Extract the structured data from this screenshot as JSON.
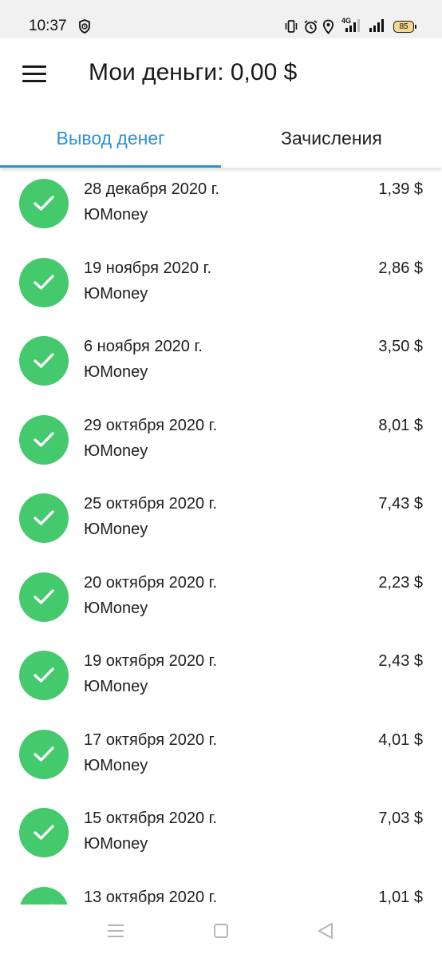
{
  "status_bar": {
    "time": "10:37",
    "battery": "85",
    "icons": [
      "shield-clock-icon",
      "vibrate-icon",
      "alarm-icon",
      "location-icon",
      "signal-4g-icon",
      "signal-icon",
      "battery-icon"
    ]
  },
  "header": {
    "menu_icon": "hamburger-menu-icon",
    "title": "Мои деньги: 0,00 $"
  },
  "tabs": [
    {
      "label": "Вывод денег",
      "active": true
    },
    {
      "label": "Зачисления",
      "active": false
    }
  ],
  "colors": {
    "accent": "#2d8fd6",
    "success": "#45c96d"
  },
  "transactions": [
    {
      "date": "28 декабря 2020 г.",
      "recipient": "ЮMoney",
      "amount": "1,39 $",
      "status_icon": "check-icon"
    },
    {
      "date": "19 ноября 2020 г.",
      "recipient": "ЮMoney",
      "amount": "2,86 $",
      "status_icon": "check-icon"
    },
    {
      "date": "6 ноября 2020 г.",
      "recipient": "ЮMoney",
      "amount": "3,50 $",
      "status_icon": "check-icon"
    },
    {
      "date": "29 октября 2020 г.",
      "recipient": "ЮMoney",
      "amount": "8,01 $",
      "status_icon": "check-icon"
    },
    {
      "date": "25 октября 2020 г.",
      "recipient": "ЮMoney",
      "amount": "7,43 $",
      "status_icon": "check-icon"
    },
    {
      "date": "20 октября 2020 г.",
      "recipient": "ЮMoney",
      "amount": "2,23 $",
      "status_icon": "check-icon"
    },
    {
      "date": "19 октября 2020 г.",
      "recipient": "ЮMoney",
      "amount": "2,43 $",
      "status_icon": "check-icon"
    },
    {
      "date": "17 октября 2020 г.",
      "recipient": "ЮMoney",
      "amount": "4,01 $",
      "status_icon": "check-icon"
    },
    {
      "date": "15 октября 2020 г.",
      "recipient": "ЮMoney",
      "amount": "7,03 $",
      "status_icon": "check-icon"
    },
    {
      "date": "13 октября 2020 г.",
      "recipient": "",
      "amount": "1,01 $",
      "status_icon": "check-icon"
    }
  ],
  "nav_bar": {
    "icons": [
      "recent-apps-icon",
      "home-icon",
      "back-icon"
    ]
  }
}
